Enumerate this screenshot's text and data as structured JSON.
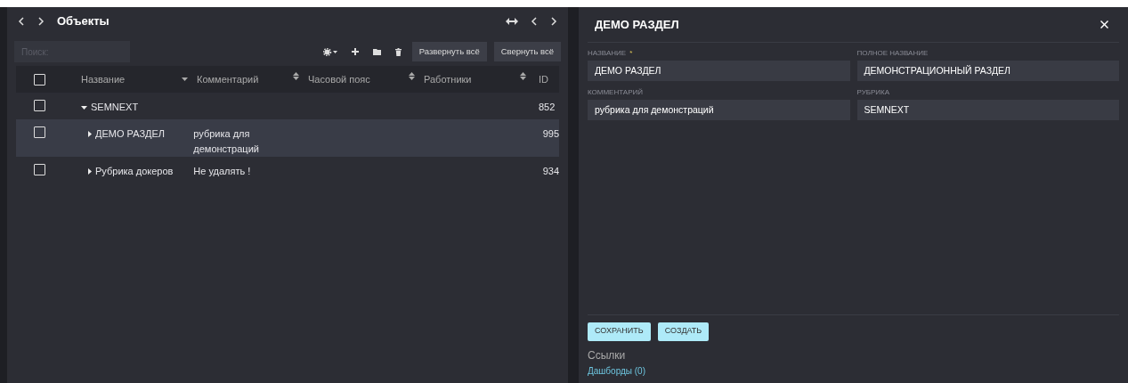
{
  "left_panel": {
    "title": "Объекты",
    "search": {
      "placeholder": "Поиск:"
    },
    "toolbar_buttons": [
      "Развернуть всё",
      "Свернуть всё"
    ],
    "table": {
      "select_all": {
        "checked": false
      },
      "columns": [
        {
          "label": "Название",
          "sortable": true,
          "sorted": true
        },
        {
          "label": "Комментарий",
          "sortable": true,
          "sorted": false
        },
        {
          "label": "Часовой пояс",
          "sortable": true,
          "sorted": false
        },
        {
          "label": "Работники",
          "sortable": true,
          "sorted": false
        },
        {
          "label": "ID",
          "sortable": false
        }
      ],
      "rows": [
        {
          "name": "SEMNEXT",
          "comment": "",
          "id": "852",
          "expanded": true,
          "checked": false,
          "selected": false,
          "children": [
            {
              "name": "ДЕМО РАЗДЕЛ",
              "comment": "рубрика для демонстраций",
              "id": "995",
              "expanded": false,
              "checked": false,
              "selected": true
            },
            {
              "name": "Рубрика докеров",
              "comment": "Не удалять !",
              "id": "934",
              "expanded": false,
              "checked": false,
              "selected": false
            }
          ]
        }
      ]
    }
  },
  "right_panel": {
    "title": "ДЕМО РАЗДЕЛ",
    "fields": [
      {
        "label": "НАЗВАНИЕ",
        "required_mark": "*",
        "value": "ДЕМО РАЗДЕЛ"
      },
      {
        "label": "ПОЛНОЕ НАЗВАНИЕ",
        "value": "ДЕМОНСТРАЦИОННЫЙ РАЗДЕЛ"
      },
      {
        "label": "КОММЕНТАРИЙ",
        "value": "рубрика для демонстраций"
      },
      {
        "label": "РУБРИКА",
        "value": "SEMNEXT"
      }
    ],
    "buttons": [
      "СОХРАНИТЬ",
      "СОЗДАТЬ"
    ],
    "links_heading": "Ссылки",
    "links": [
      "Дашборды (0)"
    ]
  }
}
